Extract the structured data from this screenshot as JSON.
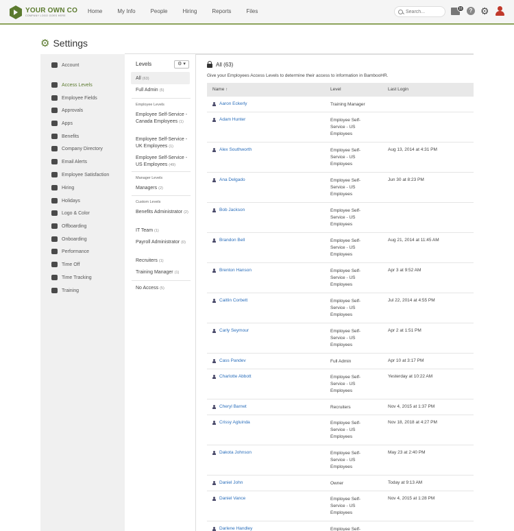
{
  "brand": {
    "name": "YOUR OWN CO",
    "tagline": "COMPANY LOGO GOES HERE"
  },
  "nav": [
    "Home",
    "My Info",
    "People",
    "Hiring",
    "Reports",
    "Files"
  ],
  "search": {
    "placeholder": "Search..."
  },
  "inbox_count": "16",
  "help_label": "?",
  "page_title": "Settings",
  "sidebar": [
    {
      "label": "Account",
      "icon": "wrench-icon"
    },
    {
      "label": "Access Levels",
      "icon": "lock-icon",
      "active": true
    },
    {
      "label": "Employee Fields",
      "icon": "list-icon"
    },
    {
      "label": "Approvals",
      "icon": "thumbs-up-icon"
    },
    {
      "label": "Apps",
      "icon": "cloud-icon"
    },
    {
      "label": "Benefits",
      "icon": "heart-icon"
    },
    {
      "label": "Company Directory",
      "icon": "directory-icon"
    },
    {
      "label": "Email Alerts",
      "icon": "envelope-icon"
    },
    {
      "label": "Employee Satisfaction",
      "icon": "smile-icon"
    },
    {
      "label": "Hiring",
      "icon": "megaphone-icon"
    },
    {
      "label": "Holidays",
      "icon": "calendar-icon"
    },
    {
      "label": "Logo & Color",
      "icon": "palette-icon"
    },
    {
      "label": "Offboarding",
      "icon": "offboarding-icon"
    },
    {
      "label": "Onboarding",
      "icon": "onboarding-icon"
    },
    {
      "label": "Performance",
      "icon": "gauge-icon"
    },
    {
      "label": "Time Off",
      "icon": "plane-icon"
    },
    {
      "label": "Time Tracking",
      "icon": "stopwatch-icon"
    },
    {
      "label": "Training",
      "icon": "graduation-cap-icon"
    }
  ],
  "levels": {
    "title": "Levels",
    "gear_label": "⚙ ▾",
    "all": {
      "label": "All",
      "count": "(63)"
    },
    "full_admin": {
      "label": "Full Admin",
      "count": "(5)"
    },
    "employee_heading": "Employee Levels",
    "employee": [
      {
        "label": "Employee Self-Service - Canada Employees",
        "count": "(1)"
      },
      {
        "label": "Employee Self-Service - UK Employees",
        "count": "(1)"
      },
      {
        "label": "Employee Self-Service - US Employees",
        "count": "(49)"
      }
    ],
    "manager_heading": "Manager Levels",
    "manager": [
      {
        "label": "Managers",
        "count": "(2)"
      }
    ],
    "custom_heading": "Custom Levels",
    "custom": [
      {
        "label": "Benefits Administrator",
        "count": "(2)"
      },
      {
        "label": "IT Team",
        "count": "(1)"
      },
      {
        "label": "Payroll Administrator",
        "count": "(0)"
      },
      {
        "label": "Recruiters",
        "count": "(1)"
      },
      {
        "label": "Training Manager",
        "count": "(1)"
      }
    ],
    "no_access": {
      "label": "No Access",
      "count": "(5)"
    }
  },
  "main": {
    "title": "All (63)",
    "description": "Give your Employees Access Levels to determine their access to information in BambooHR.",
    "columns": {
      "name": "Name ↑",
      "level": "Level",
      "last_login": "Last Login"
    },
    "rows": [
      {
        "name": "Aaron Eckerly",
        "level": "Training Manager",
        "last_login": ""
      },
      {
        "name": "Adam Hunter",
        "level": "Employee Self-Service - US Employees",
        "last_login": ""
      },
      {
        "name": "Alex Southworth",
        "level": "Employee Self-Service - US Employees",
        "last_login": "Aug 13, 2014 at 4:31 PM"
      },
      {
        "name": "Ana Delgado",
        "level": "Employee Self-Service - US Employees",
        "last_login": "Jun 30 at 8:23 PM"
      },
      {
        "name": "Bob Jackson",
        "level": "Employee Self-Service - US Employees",
        "last_login": ""
      },
      {
        "name": "Brandon Bell",
        "level": "Employee Self-Service - US Employees",
        "last_login": "Aug 21, 2014 at 11:45 AM"
      },
      {
        "name": "Brenton Hanson",
        "level": "Employee Self-Service - US Employees",
        "last_login": "Apr 3 at 9:52 AM"
      },
      {
        "name": "Caitlin Corbett",
        "level": "Employee Self-Service - US Employees",
        "last_login": "Jul 22, 2014 at 4:55 PM"
      },
      {
        "name": "Carly Seymour",
        "level": "Employee Self-Service - US Employees",
        "last_login": "Apr 2 at 1:51 PM"
      },
      {
        "name": "Cass Pandev",
        "level": "Full Admin",
        "last_login": "Apr 10 at 3:17 PM"
      },
      {
        "name": "Charlotte Abbott",
        "level": "Employee Self-Service - US Employees",
        "last_login": "Yesterday at 10:22 AM"
      },
      {
        "name": "Cheryl Barnet",
        "level": "Recruiters",
        "last_login": "Nov 4, 2015 at 1:37 PM"
      },
      {
        "name": "Crissy Agluinda",
        "level": "Employee Self-Service - US Employees",
        "last_login": "Nov 18, 2018 at 4:27 PM"
      },
      {
        "name": "Dakota Johnson",
        "level": "Employee Self-Service - US Employees",
        "last_login": "May 23 at 2:40 PM"
      },
      {
        "name": "Daniel John",
        "level": "Owner",
        "last_login": "Today at 9:13 AM"
      },
      {
        "name": "Daniel Vance",
        "level": "Employee Self-Service - US Employees",
        "last_login": "Nov 4, 2015 at 1:28 PM"
      },
      {
        "name": "Darlene Handley",
        "level": "Employee Self-",
        "last_login": ""
      }
    ]
  }
}
